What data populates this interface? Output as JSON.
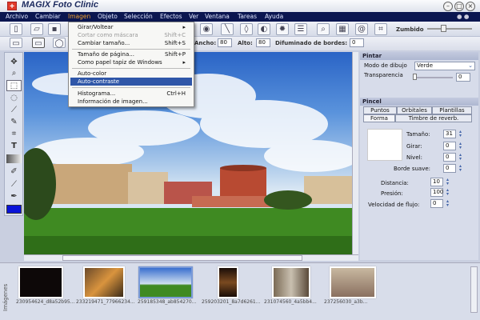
{
  "app": {
    "title": "MAGIX Foto Clinic",
    "icon": "red-cross-icon"
  },
  "menubar": [
    "Archivo",
    "Cambiar",
    "Imagen",
    "Objeto",
    "Selección",
    "Efectos",
    "Ver",
    "Ventana",
    "Tareas",
    "Ayuda"
  ],
  "imagen_menu": [
    {
      "label": "Girar/Voltear",
      "shortcut": "",
      "submenu": true
    },
    {
      "label": "Cortar como máscara",
      "shortcut": "Shift+C",
      "disabled": true
    },
    {
      "label": "Cambiar tamaño...",
      "shortcut": "Shift+S"
    },
    {
      "label": "Tamaño de página...",
      "shortcut": "Shift+P"
    },
    {
      "label": "Como papel tapiz de Windows",
      "shortcut": "",
      "submenu": true
    },
    {
      "label": "Auto-color",
      "shortcut": ""
    },
    {
      "label": "Auto-contraste",
      "shortcut": "",
      "highlighted": true
    },
    {
      "label": "Histograma...",
      "shortcut": "Ctrl+H"
    },
    {
      "label": "Información de imagen...",
      "shortcut": ""
    }
  ],
  "toolbar": {
    "zoom_label": "Zumbido",
    "zoom_level": 0.35
  },
  "options": {
    "ancho_label": "Ancho:",
    "ancho": "80",
    "alto_label": "Alto:",
    "alto": "80",
    "difuminado_label": "Difuminado de bordes:",
    "difuminado": "0"
  },
  "pintar": {
    "title": "Pintar",
    "modo_label": "Modo de dibujo",
    "modo": "Verde",
    "transparencia_label": "Transparencia",
    "transparencia": "0"
  },
  "pincel": {
    "title": "Pincel",
    "tabs_top": [
      "Puntos",
      "Orbitales",
      "Plantillas"
    ],
    "tabs_bottom": [
      "Forma",
      "Timbre de reverb."
    ],
    "tamano_label": "Tamaño:",
    "tamano": "31",
    "girar_label": "Girar:",
    "girar": "0",
    "nivel_label": "Nivel:",
    "nivel": "0",
    "borde_label": "Borde suave:",
    "borde": "0",
    "distancia_label": "Distancia:",
    "distancia": "10",
    "presion_label": "Presión:",
    "presion": "100",
    "velocidad_label": "Velocidad de flujo:",
    "velocidad": "0"
  },
  "strip": {
    "label": "Imágenes",
    "thumbs": [
      "230954624_d8a52b95...",
      "233219471_77966234...",
      "259185348_ab854270...",
      "259203201_8a7d6261...",
      "231074560_4a5bb4...",
      "237256030_a3b..."
    ]
  },
  "colors": {
    "foreground": "#0a14d8",
    "menubar": "#0b1650",
    "highlight": "#2f56a8"
  }
}
